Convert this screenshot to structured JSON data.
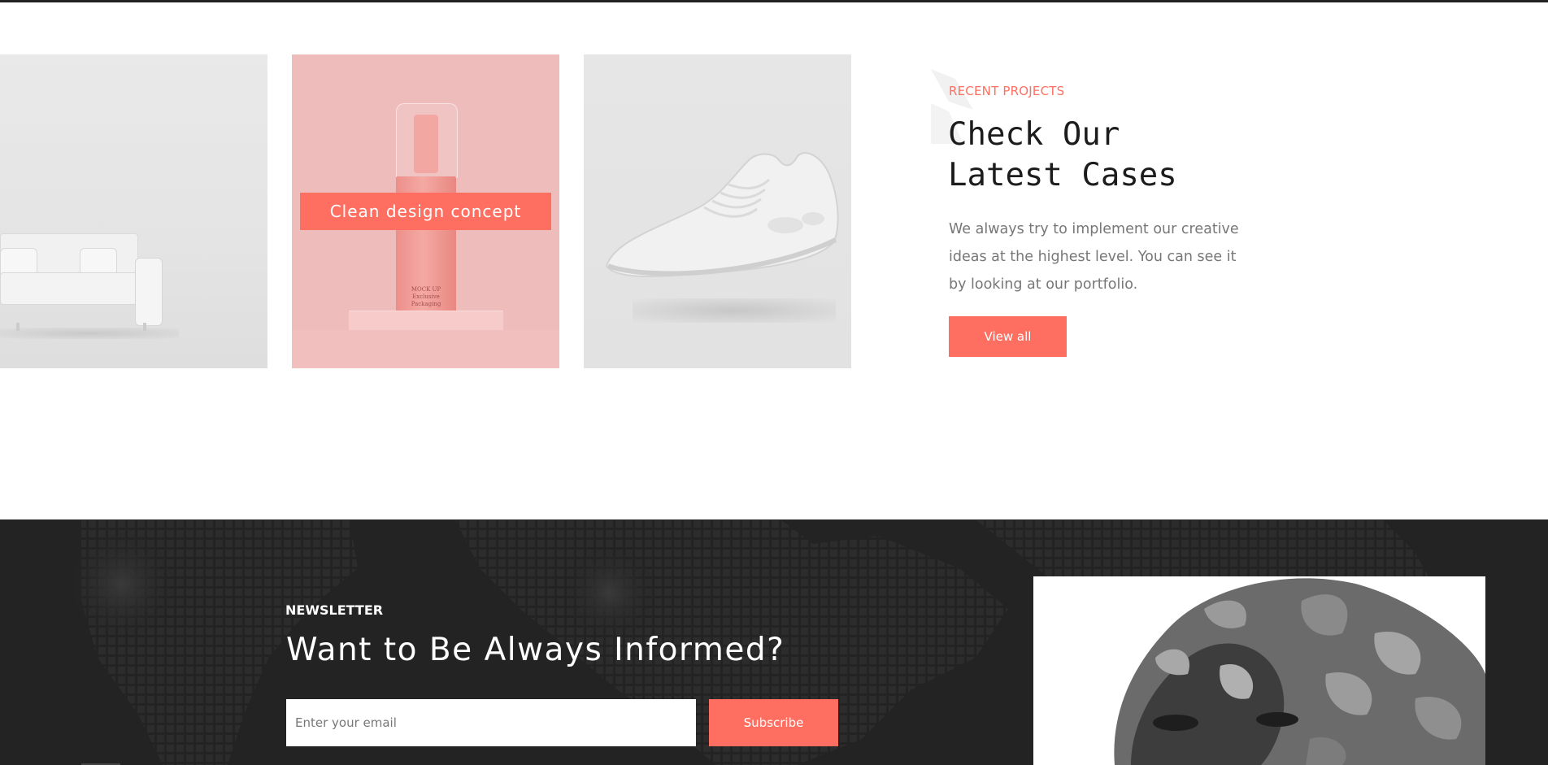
{
  "projects": {
    "cards": [
      {
        "alt": "sofa-product-image"
      },
      {
        "alt": "cosmetic-bottle-image",
        "title": "Clean design concept",
        "bottle_label": "MOCK UP Exclusive Packaging"
      },
      {
        "alt": "sneaker-product-image"
      }
    ],
    "eyebrow": "RECENT PROJECTS",
    "headline_line1": "Check Our",
    "headline_line2": "Latest Cases",
    "lead": "We always try to implement our creative ideas at the highest level. You can see it by looking at our portfolio.",
    "view_all_label": "View all"
  },
  "newsletter": {
    "eyebrow": "NEWSLETTER",
    "title": "Want to Be Always Informed?",
    "email_placeholder": "Enter your email",
    "email_value": "",
    "subscribe_label": "Subscribe"
  },
  "colors": {
    "accent": "#ff6f61",
    "dark_bg": "#232323",
    "heading": "#1c1c1c",
    "body_text": "#777777"
  }
}
